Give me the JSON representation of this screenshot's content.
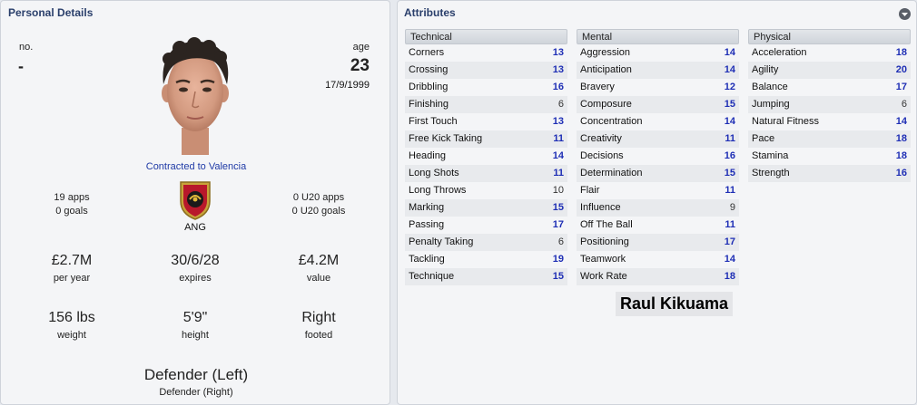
{
  "personal": {
    "title": "Personal Details",
    "no_label": "no.",
    "no_value": "-",
    "age_label": "age",
    "age_value": "23",
    "dob": "17/9/1999",
    "contract": "Contracted to Valencia",
    "apps": "19 apps",
    "goals": "0 goals",
    "u20_apps": "0 U20 apps",
    "u20_goals": "0 U20 goals",
    "nationality": "ANG",
    "wage": "£2.7M",
    "wage_label": "per year",
    "expires": "30/6/28",
    "expires_label": "expires",
    "value": "£4.2M",
    "value_label": "value",
    "weight": "156 lbs",
    "weight_label": "weight",
    "height": "5'9\"",
    "height_label": "height",
    "foot": "Right",
    "foot_label": "footed",
    "position": "Defender (Left)",
    "secondary_position": "Defender (Right)"
  },
  "attributes": {
    "title": "Attributes",
    "technical": {
      "header": "Technical",
      "rows": [
        {
          "name": "Corners",
          "value": "13"
        },
        {
          "name": "Crossing",
          "value": "13"
        },
        {
          "name": "Dribbling",
          "value": "16"
        },
        {
          "name": "Finishing",
          "value": "6"
        },
        {
          "name": "First Touch",
          "value": "13"
        },
        {
          "name": "Free Kick Taking",
          "value": "11"
        },
        {
          "name": "Heading",
          "value": "14"
        },
        {
          "name": "Long Shots",
          "value": "11"
        },
        {
          "name": "Long Throws",
          "value": "10"
        },
        {
          "name": "Marking",
          "value": "15"
        },
        {
          "name": "Passing",
          "value": "17"
        },
        {
          "name": "Penalty Taking",
          "value": "6"
        },
        {
          "name": "Tackling",
          "value": "19"
        },
        {
          "name": "Technique",
          "value": "15"
        }
      ]
    },
    "mental": {
      "header": "Mental",
      "rows": [
        {
          "name": "Aggression",
          "value": "14"
        },
        {
          "name": "Anticipation",
          "value": "14"
        },
        {
          "name": "Bravery",
          "value": "12"
        },
        {
          "name": "Composure",
          "value": "15"
        },
        {
          "name": "Concentration",
          "value": "14"
        },
        {
          "name": "Creativity",
          "value": "11"
        },
        {
          "name": "Decisions",
          "value": "16"
        },
        {
          "name": "Determination",
          "value": "15"
        },
        {
          "name": "Flair",
          "value": "11"
        },
        {
          "name": "Influence",
          "value": "9"
        },
        {
          "name": "Off The Ball",
          "value": "11"
        },
        {
          "name": "Positioning",
          "value": "17"
        },
        {
          "name": "Teamwork",
          "value": "14"
        },
        {
          "name": "Work Rate",
          "value": "18"
        }
      ]
    },
    "physical": {
      "header": "Physical",
      "rows": [
        {
          "name": "Acceleration",
          "value": "18"
        },
        {
          "name": "Agility",
          "value": "20"
        },
        {
          "name": "Balance",
          "value": "17"
        },
        {
          "name": "Jumping",
          "value": "6"
        },
        {
          "name": "Natural Fitness",
          "value": "14"
        },
        {
          "name": "Pace",
          "value": "18"
        },
        {
          "name": "Stamina",
          "value": "18"
        },
        {
          "name": "Strength",
          "value": "16"
        }
      ]
    }
  },
  "player_name": "Raul Kikuama",
  "colors": {
    "title": "#2a3f6b",
    "link": "#1f3aa6",
    "attr_high": "#1f2fb5",
    "attr_low": "#333333"
  }
}
